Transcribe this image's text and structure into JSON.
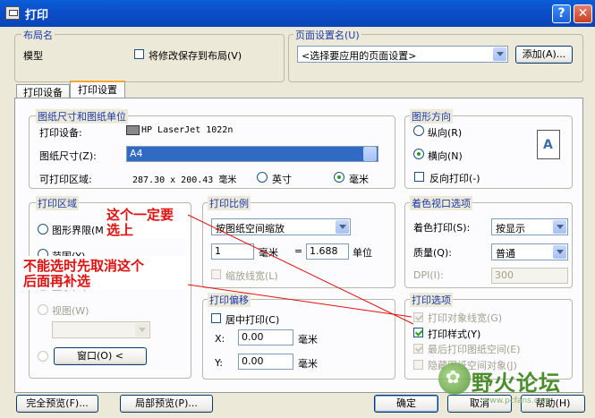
{
  "window": {
    "title": "打印"
  },
  "layout_group": {
    "label": "布局名",
    "name": "模型",
    "save_changes": "将修改保存到布局(V)"
  },
  "page_setup_group": {
    "label": "页面设置名(U)",
    "selected": "<选择要应用的页面设置>",
    "add_button": "添加(A)..."
  },
  "tabs": [
    {
      "label": "打印设备"
    },
    {
      "label": "打印设置"
    }
  ],
  "paper_group": {
    "label": "图纸尺寸和图纸单位",
    "device_label": "打印设备:",
    "device_value": "HP LaserJet 1022n",
    "size_label": "图纸尺寸(Z):",
    "size_value": "A4",
    "area_label": "可打印区域:",
    "area_value": "287.30 x 200.43 毫米",
    "unit_inch": "英寸",
    "unit_mm": "毫米",
    "unit_selected": "mm"
  },
  "orientation_group": {
    "label": "图形方向",
    "portrait": "纵向(R)",
    "landscape": "横向(N)",
    "reverse": "反向打印(-)",
    "selected": "landscape"
  },
  "print_area_group": {
    "label": "打印区域",
    "limits": "图形界限(M)",
    "range": "范围(Y)",
    "display": "显示(D)",
    "view": "视图(W)",
    "window_button": "窗口(O) <"
  },
  "scale_group": {
    "label": "打印比例",
    "scale_value": "按图纸空间缩放",
    "value1": "1",
    "unit1": "毫米",
    "equals": "=",
    "value2": "1.688",
    "unit2": "单位",
    "scale_lineweights": "缩放线宽(L)"
  },
  "offset_group": {
    "label": "打印偏移",
    "center": "居中打印(C)",
    "x_label": "X:",
    "x_value": "0.00",
    "x_unit": "毫米",
    "y_label": "Y:",
    "y_value": "0.00",
    "y_unit": "毫米"
  },
  "shade_group": {
    "label": "着色视口选项",
    "shade_label": "着色打印(S):",
    "shade_value": "按显示",
    "quality_label": "质量(Q):",
    "quality_value": "普通",
    "dpi_label": "DPI(I):",
    "dpi_value": "300"
  },
  "options_group": {
    "label": "打印选项",
    "items": [
      {
        "label": "打印对象线宽(G)",
        "checked": true,
        "disabled": true
      },
      {
        "label": "打印样式(Y)",
        "checked": true,
        "disabled": false
      },
      {
        "label": "最后打印图纸空间(E)",
        "checked": true,
        "disabled": true
      },
      {
        "label": "隐藏图纸空间对象(J)",
        "checked": false,
        "disabled": true
      }
    ]
  },
  "footer": {
    "full_preview": "完全预览(F)...",
    "partial_preview": "局部预览(P)...",
    "ok": "确定",
    "cancel": "取消",
    "help": "帮助(H)"
  },
  "annotations": {
    "note1_line1": "这个一定要",
    "note1_line2": "选上",
    "note2_line1": "不能选时先取消这个",
    "note2_line2": "后面再补选",
    "color": "#e01010"
  },
  "watermark": {
    "text": "野火论坛",
    "url": "www.pcfans.com"
  },
  "colors": {
    "accent": "#316ac5",
    "titlebar": "#0a5fd8",
    "group_label": "#1c3aa9"
  }
}
